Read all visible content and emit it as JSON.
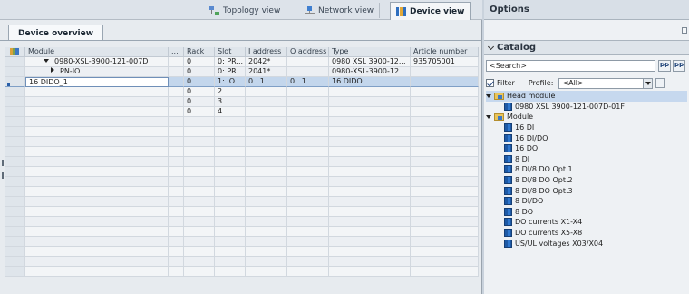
{
  "view_tabs": {
    "topology": "Topology view",
    "network": "Network view",
    "device": "Device view"
  },
  "overview_tab": "Device overview",
  "grid": {
    "columns": {
      "module": "Module",
      "dots": "...",
      "rack": "Rack",
      "slot": "Slot",
      "i_address": "I address",
      "q_address": "Q address",
      "type": "Type",
      "article": "Article number"
    },
    "rows": [
      {
        "module": "0980-XSL-3900-121-007D",
        "rack": "0",
        "slot": "0: PR...",
        "i_address": "2042*",
        "q_address": "",
        "type": "0980 XSL 3900-12...",
        "article": "935705001"
      },
      {
        "module": "PN-IO",
        "rack": "0",
        "slot": "0: PR...",
        "i_address": "2041*",
        "q_address": "",
        "type": "0980-XSL-3900-12...",
        "article": ""
      },
      {
        "module": "16 DIDO_1",
        "rack": "0",
        "slot": "1: IO ...",
        "i_address": "0...1",
        "q_address": "0...1",
        "type": "16 DIDO",
        "article": ""
      },
      {
        "module": "",
        "rack": "0",
        "slot": "2",
        "i_address": "",
        "q_address": "",
        "type": "",
        "article": ""
      },
      {
        "module": "",
        "rack": "0",
        "slot": "3",
        "i_address": "",
        "q_address": "",
        "type": "",
        "article": ""
      },
      {
        "module": "",
        "rack": "0",
        "slot": "4",
        "i_address": "",
        "q_address": "",
        "type": "",
        "article": ""
      }
    ]
  },
  "options": {
    "title": "Options",
    "catalog_title": "Catalog",
    "search_placeholder": "<Search>",
    "filter_label": "Filter",
    "profile_label": "Profile:",
    "profile_value": "<All>",
    "search_btn1": "ÞÞ",
    "search_btn2": "ÞÞ"
  },
  "catalog_tree": {
    "head_module": "Head module",
    "head_item": "0980 XSL 3900-121-007D-01F",
    "module": "Module",
    "modules": [
      "16 DI",
      "16 DI/DO",
      "16 DO",
      "8 DI",
      "8 DI/8 DO Opt.1",
      "8 DI/8 DO Opt.2",
      "8 DI/8 DO Opt.3",
      "8 DI/DO",
      "8 DO",
      "DO currents X1-X4",
      "DO currents X5-X8",
      "US/UL voltages X03/X04"
    ]
  }
}
